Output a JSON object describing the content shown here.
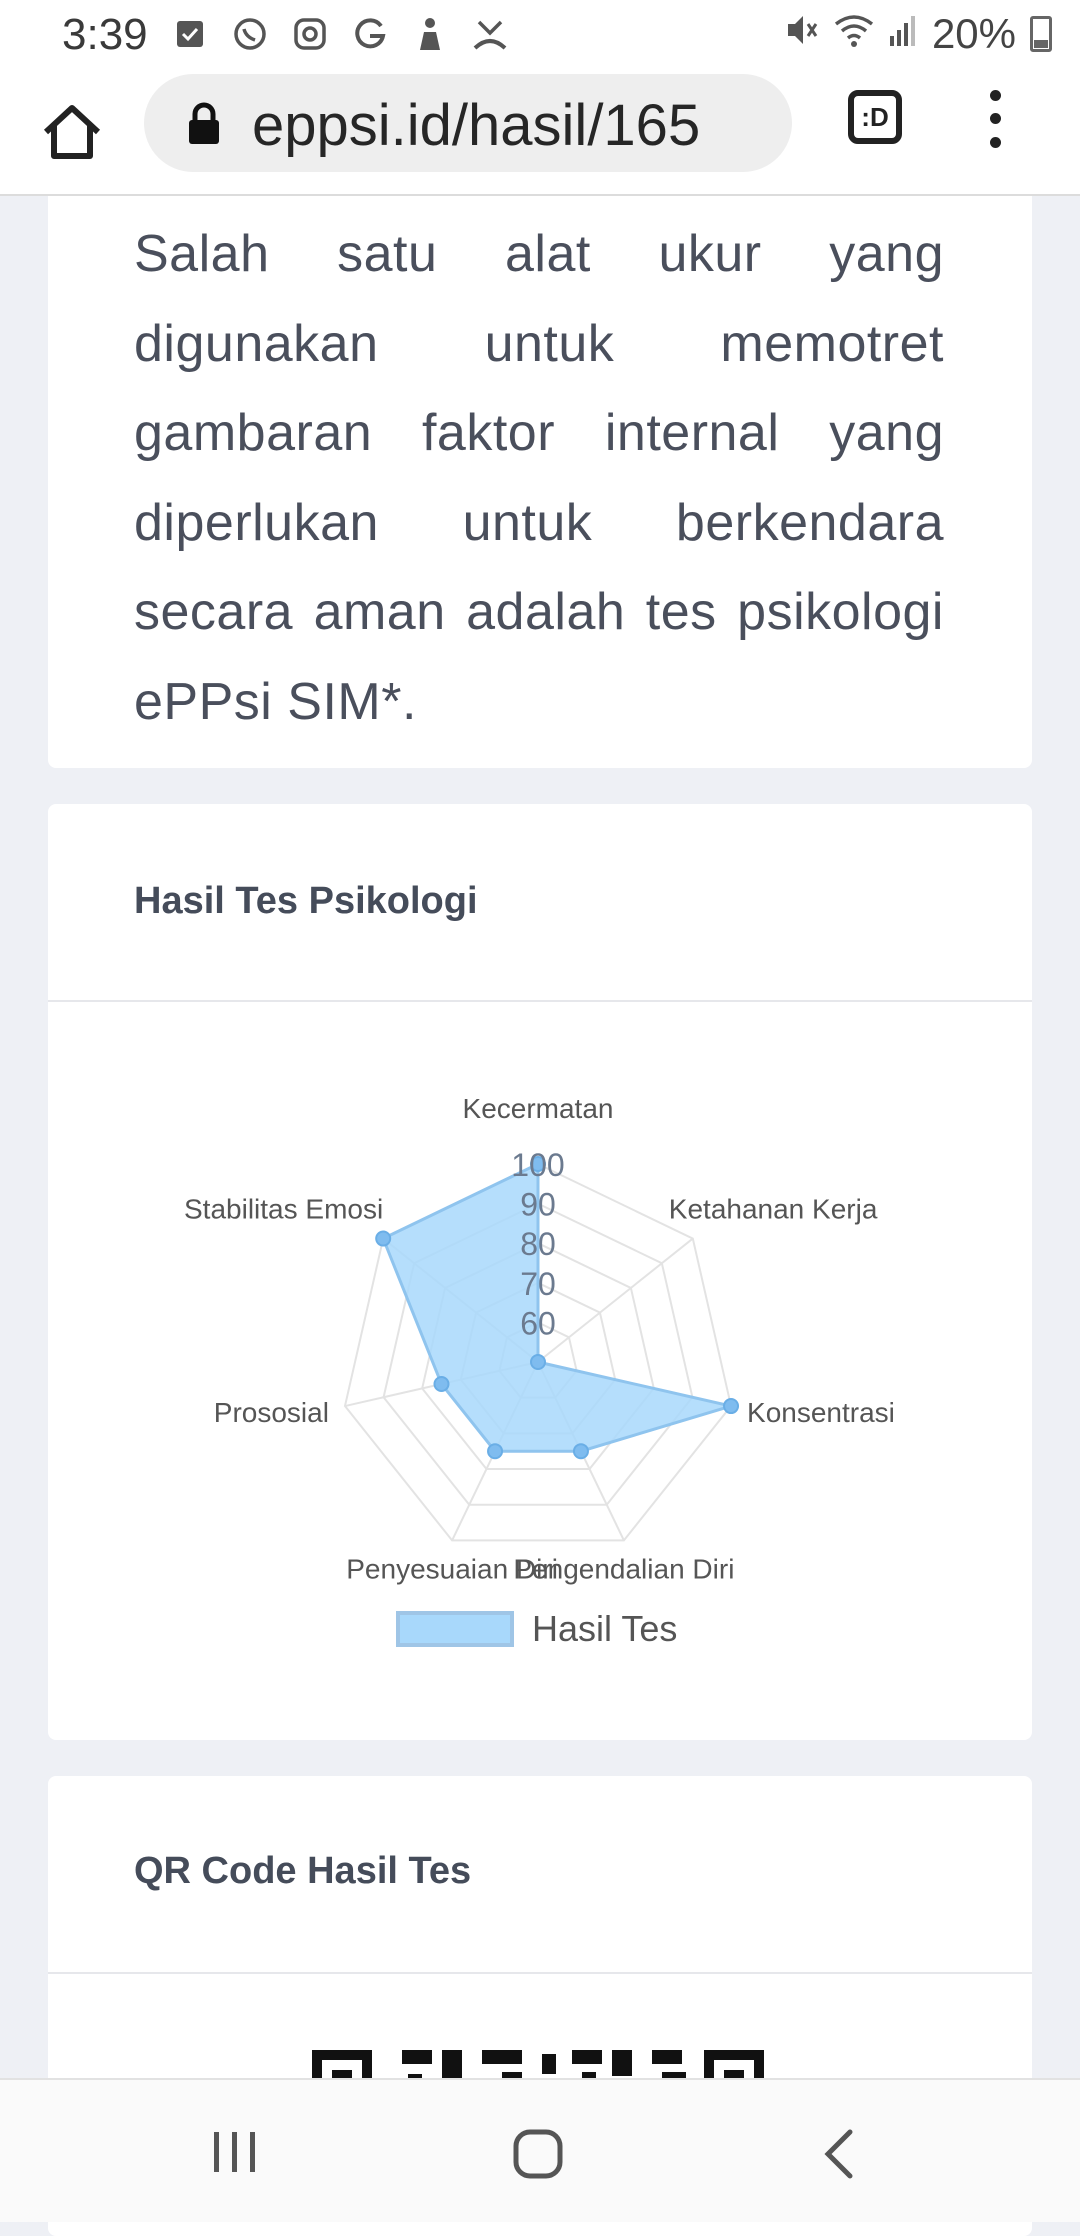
{
  "status_bar": {
    "time": "3:39",
    "notification_icons": [
      "checkbox-icon",
      "whatsapp-icon",
      "instagram-icon",
      "google-icon",
      "person-icon",
      "missed-call-icon"
    ],
    "battery_percent": "20%"
  },
  "browser": {
    "url": "eppsi.id/hasil/165",
    "tab_label": ":D"
  },
  "intro_card": {
    "text": "Salah satu alat ukur yang digunakan untuk memotret gambaran faktor internal yang diperlukan untuk berkendara secara aman adalah tes psikologi ePPsi SIM*."
  },
  "results_card": {
    "title": "Hasil Tes Psikologi",
    "legend_label": "Hasil Tes"
  },
  "qr_card": {
    "title": "QR Code Hasil Tes"
  },
  "colors": {
    "fill": "#a8d8fb",
    "stroke": "#8fc4ee",
    "point": "#7fbcef",
    "grid": "#e3e3e3"
  },
  "chart_data": {
    "type": "radar",
    "categories": [
      "Kecermatan",
      "Ketahanan Kerja",
      "Konsentrasi",
      "Pengendalian Diri",
      "Penyesuaian Diri",
      "Prososial",
      "Stabilitas Emosi"
    ],
    "series": [
      {
        "name": "Hasil Tes",
        "values": [
          100,
          50,
          100,
          75,
          75,
          75,
          100
        ]
      }
    ],
    "r_ticks": [
      "60",
      "70",
      "80",
      "90",
      "100"
    ],
    "rlim": [
      50,
      100
    ],
    "legend_position": "bottom",
    "grid": true
  }
}
